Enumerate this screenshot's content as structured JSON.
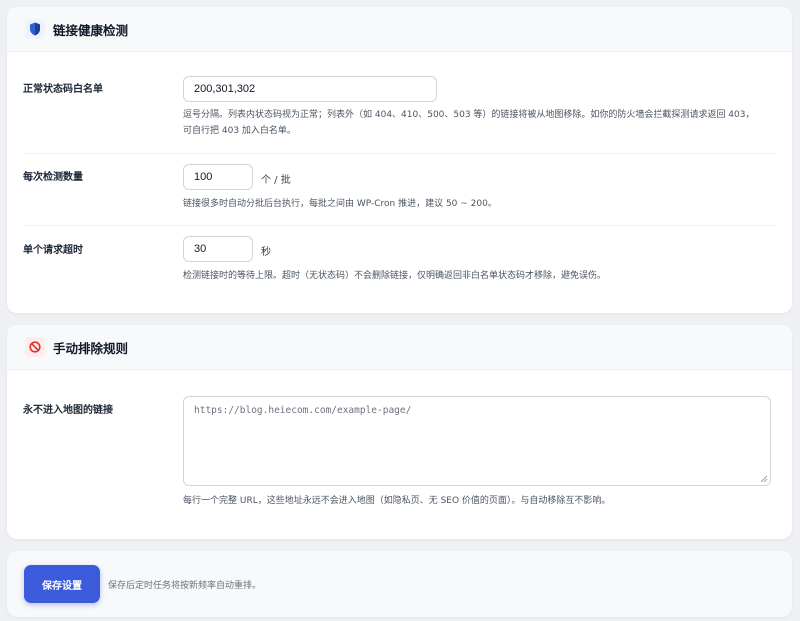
{
  "link_health": {
    "title": "链接健康检测",
    "icon": "shield-icon",
    "whitelist": {
      "label": "正常状态码白名单",
      "value": "200,301,302",
      "desc_line1": "逗号分隔。列表内状态码视为正常；列表外（如 404、410、500、503 等）的链接将被从地图移除。如你的防火墙会拦截探测请求返回 403，",
      "desc_line2": "可自行把 403 加入白名单。"
    },
    "batch": {
      "label": "每次检测数量",
      "value": "100",
      "suffix": "个 / 批",
      "desc": "链接很多时自动分批后台执行，每批之间由 WP-Cron 推进，建议 50 ~ 200。"
    },
    "timeout": {
      "label": "单个请求超时",
      "value": "30",
      "suffix": "秒",
      "desc": "检测链接时的等待上限。超时（无状态码）不会删除链接，仅明确返回非白名单状态码才移除，避免误伤。"
    }
  },
  "manual_exclude": {
    "title": "手动排除规则",
    "icon": "prohibited-icon",
    "excluded_links": {
      "label": "永不进入地图的链接",
      "placeholder": "https://blog.heiecom.com/example-page/",
      "desc": "每行一个完整 URL，这些地址永远不会进入地图（如隐私页、无 SEO 价值的页面）。与自动移除互不影响。"
    }
  },
  "footer": {
    "save_label": "保存设置",
    "hint": "保存后定时任务将按新频率自动重排。"
  },
  "colors": {
    "accent": "#3b5bdb",
    "page_bg": "#eef0f4",
    "card_bg": "#ffffff"
  }
}
